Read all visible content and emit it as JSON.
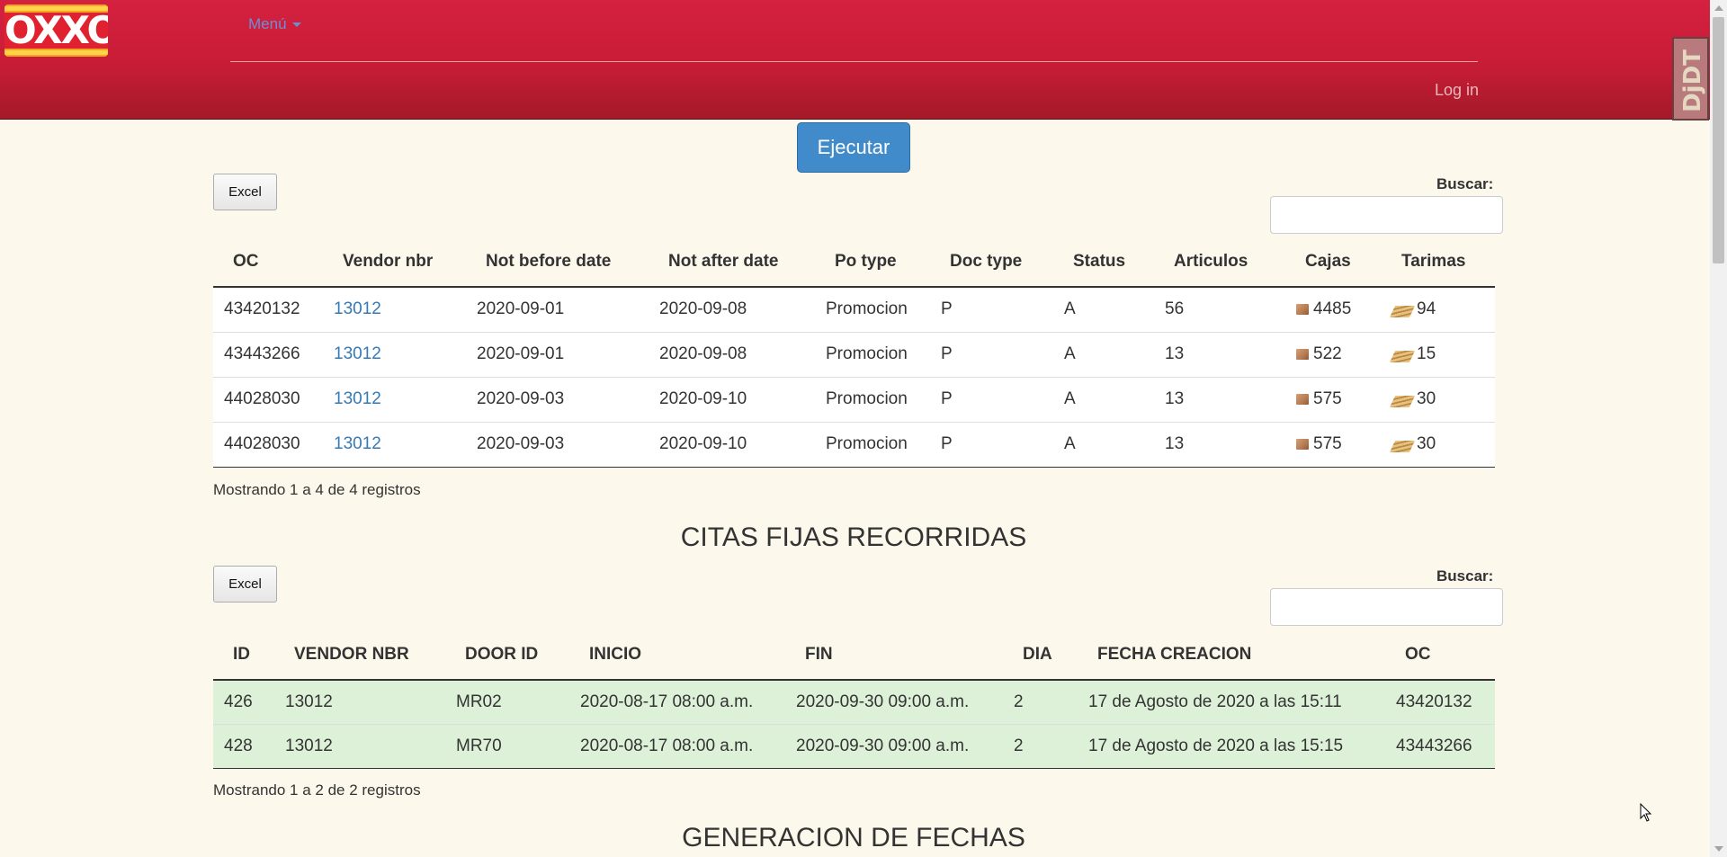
{
  "header": {
    "logo_text": "OXXO",
    "menu_label": "Menú",
    "login_label": "Log in",
    "debug_toolbar_label": "DjDT"
  },
  "actions": {
    "run_label": "Ejecutar"
  },
  "orders": {
    "excel_label": "Excel",
    "search_label": "Buscar:",
    "columns": [
      "OC",
      "Vendor nbr",
      "Not before date",
      "Not after date",
      "Po type",
      "Doc type",
      "Status",
      "Articulos",
      "Cajas",
      "Tarimas"
    ],
    "rows": [
      {
        "oc": "43420132",
        "vendor": "13012",
        "nbd": "2020-09-01",
        "nad": "2020-09-08",
        "po_type": "Promocion",
        "doc_type": "P",
        "status": "A",
        "articulos": "56",
        "cajas": "4485",
        "tarimas": "94"
      },
      {
        "oc": "43443266",
        "vendor": "13012",
        "nbd": "2020-09-01",
        "nad": "2020-09-08",
        "po_type": "Promocion",
        "doc_type": "P",
        "status": "A",
        "articulos": "13",
        "cajas": "522",
        "tarimas": "15"
      },
      {
        "oc": "44028030",
        "vendor": "13012",
        "nbd": "2020-09-03",
        "nad": "2020-09-10",
        "po_type": "Promocion",
        "doc_type": "P",
        "status": "A",
        "articulos": "13",
        "cajas": "575",
        "tarimas": "30"
      },
      {
        "oc": "44028030",
        "vendor": "13012",
        "nbd": "2020-09-03",
        "nad": "2020-09-10",
        "po_type": "Promocion",
        "doc_type": "P",
        "status": "A",
        "articulos": "13",
        "cajas": "575",
        "tarimas": "30"
      }
    ],
    "info": "Mostrando 1 a 4 de 4 registros",
    "icons": {
      "cajas": "box-icon",
      "tarimas": "pallet-icon"
    }
  },
  "citas": {
    "title": "CITAS FIJAS RECORRIDAS",
    "excel_label": "Excel",
    "search_label": "Buscar:",
    "columns": [
      "ID",
      "VENDOR NBR",
      "DOOR ID",
      "INICIO",
      "FIN",
      "DIA",
      "FECHA CREACION",
      "OC"
    ],
    "rows": [
      {
        "id": "426",
        "vendor": "13012",
        "door": "MR02",
        "inicio": "2020-08-17 08:00 a.m.",
        "fin": "2020-09-30 09:00 a.m.",
        "dia": "2",
        "fecha": "17 de Agosto de 2020 a las 15:11",
        "oc": "43420132"
      },
      {
        "id": "428",
        "vendor": "13012",
        "door": "MR70",
        "inicio": "2020-08-17 08:00 a.m.",
        "fin": "2020-09-30 09:00 a.m.",
        "dia": "2",
        "fecha": "17 de Agosto de 2020 a las 15:15",
        "oc": "43443266"
      }
    ],
    "info": "Mostrando 1 a 2 de 2 registros"
  },
  "generacion": {
    "title": "GENERACION DE FECHAS"
  },
  "colors": {
    "header_red": "#c81c36",
    "primary_button": "#428bca",
    "link": "#337ab7",
    "row_highlight": "#ddf0d8",
    "page_background": "#fdf8ec"
  }
}
